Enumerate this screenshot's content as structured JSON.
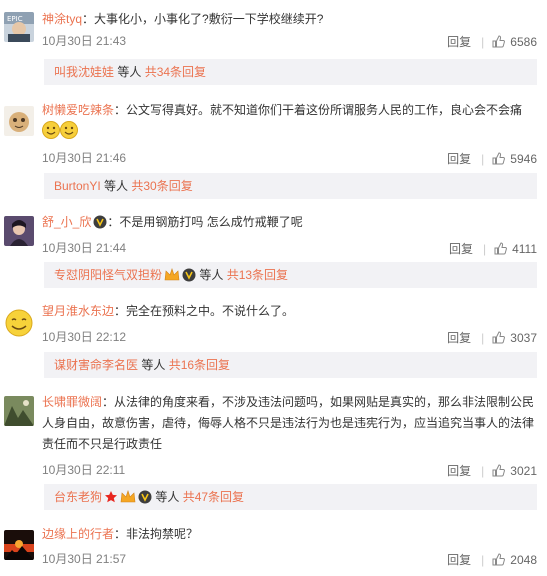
{
  "colors": {
    "username": "#eb7350",
    "meta": "#808080",
    "reply_bg": "#f2f2f5"
  },
  "comments": [
    {
      "user": "神涂tyq",
      "text": "：大事化小，小事化了?敷衍一下学校继续开?",
      "time": "10月30日 21:43",
      "reply_label": "回复",
      "likes": "6586",
      "replies": {
        "names": "叫我沈娃娃",
        "middle": " 等人 ",
        "count": "共34条回复"
      }
    },
    {
      "user": "树懒爱吃辣条",
      "text": "：公文写得真好。就不知道你们干着这份所谓服务人民的工作，良心会不会痛",
      "time": "10月30日 21:46",
      "reply_label": "回复",
      "likes": "5946",
      "replies": {
        "names": "BurtonYI",
        "middle": " 等人 ",
        "count": "共30条回复"
      }
    },
    {
      "user": "舒_小_欣",
      "text": "：不是用钢筋打吗 怎么成竹戒鞭了呢",
      "time": "10月30日 21:44",
      "reply_label": "回复",
      "likes": "4111",
      "replies": {
        "names": "专怼阴阳怪气双担粉",
        "middle": " 等人 ",
        "count": "共13条回复"
      }
    },
    {
      "user": "望月淮水东边",
      "text": "：完全在预料之中。不说什么了。",
      "time": "10月30日 22:12",
      "reply_label": "回复",
      "likes": "3037",
      "replies": {
        "names": "谋财害命李名医",
        "middle": " 等人 ",
        "count": "共16条回复"
      }
    },
    {
      "user": "长啸罪微阔",
      "text": "：从法律的角度来看，不涉及违法问题吗，如果网贴是真实的，那么非法限制公民人身自由，故意伤害，虐待，侮辱人格不只是违法行为也是违宪行为，应当追究当事人的法律责任而不只是行政责任",
      "time": "10月30日 22:11",
      "reply_label": "回复",
      "likes": "3021",
      "replies": {
        "names": "台东老狗",
        "middle": " 等人 ",
        "count": "共47条回复"
      }
    },
    {
      "user": "边缘上的行者",
      "text": "：非法拘禁呢？",
      "time": "10月30日 21:57",
      "reply_label": "回复",
      "likes": "2048"
    }
  ]
}
